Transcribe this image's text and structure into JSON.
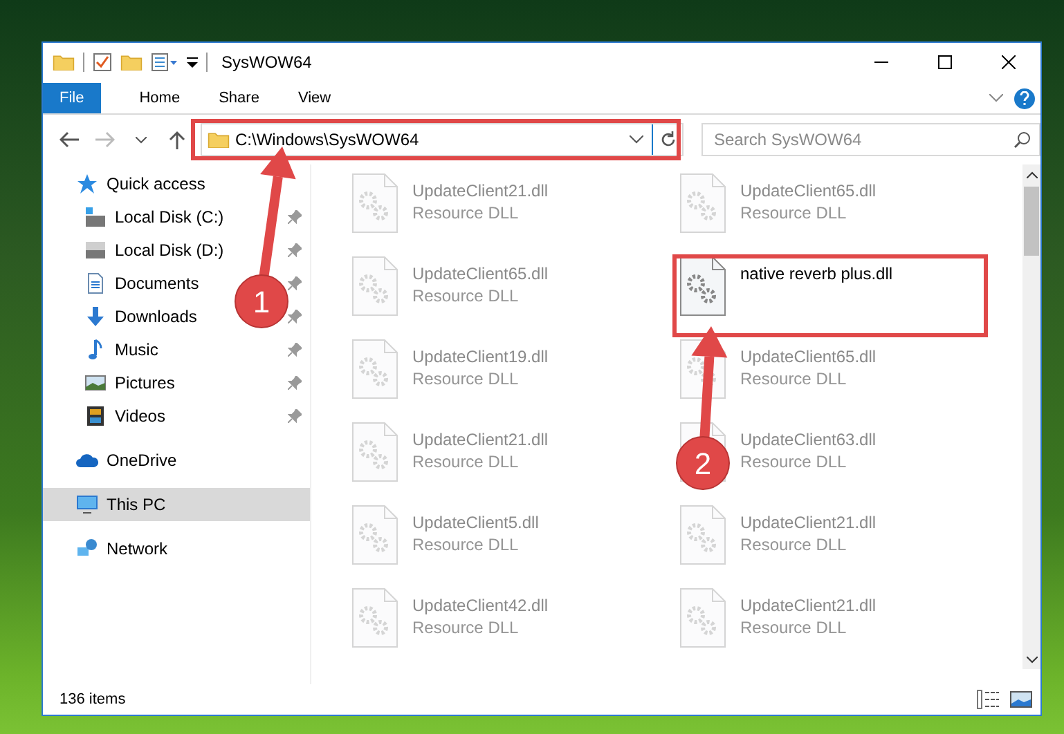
{
  "window": {
    "title": "SysWOW64"
  },
  "ribbon_tabs": [
    {
      "label": "File",
      "kind": "file"
    },
    {
      "label": "Home",
      "kind": "tab"
    },
    {
      "label": "Share",
      "kind": "tab"
    },
    {
      "label": "View",
      "kind": "tab"
    }
  ],
  "address_bar": {
    "path": "C:\\Windows\\SysWOW64"
  },
  "search": {
    "placeholder": "Search SysWOW64"
  },
  "sidebar": {
    "items": [
      {
        "label": "Quick access",
        "selected": false,
        "children": [
          {
            "label": "Local Disk (C:)",
            "pinned": true
          },
          {
            "label": "Local Disk (D:)",
            "pinned": true
          },
          {
            "label": "Documents",
            "pinned": true
          },
          {
            "label": "Downloads",
            "pinned": true
          },
          {
            "label": "Music",
            "pinned": true
          },
          {
            "label": "Pictures",
            "pinned": true
          },
          {
            "label": "Videos",
            "pinned": true
          }
        ]
      },
      {
        "label": "OneDrive",
        "selected": false
      },
      {
        "label": "This PC",
        "selected": true
      },
      {
        "label": "Network",
        "selected": false
      }
    ]
  },
  "files": [
    {
      "name": "UpdateClient21.dll",
      "type": "Resource DLL",
      "blurred": true
    },
    {
      "name": "UpdateClient65.dll",
      "type": "Resource DLL",
      "blurred": true
    },
    {
      "name": "UpdateClient65.dll",
      "type": "Resource DLL",
      "blurred": true
    },
    {
      "name": "native reverb plus.dll",
      "blurred": false
    },
    {
      "name": "UpdateClient19.dll",
      "type": "Resource DLL",
      "blurred": true
    },
    {
      "name": "UpdateClient65.dll",
      "type": "Resource DLL",
      "blurred": true
    },
    {
      "name": "UpdateClient21.dll",
      "type": "Resource DLL",
      "blurred": true
    },
    {
      "name": "UpdateClient63.dll",
      "type": "Resource DLL",
      "blurred": true
    },
    {
      "name": "UpdateClient5.dll",
      "type": "Resource DLL",
      "blurred": true
    },
    {
      "name": "UpdateClient21.dll",
      "type": "Resource DLL",
      "blurred": true
    },
    {
      "name": "UpdateClient42.dll",
      "type": "Resource DLL",
      "blurred": true
    },
    {
      "name": "UpdateClient21.dll",
      "type": "Resource DLL",
      "blurred": true
    }
  ],
  "status_bar": {
    "item_count": "136 items"
  },
  "annotations": [
    {
      "label": "1"
    },
    {
      "label": "2"
    }
  ]
}
